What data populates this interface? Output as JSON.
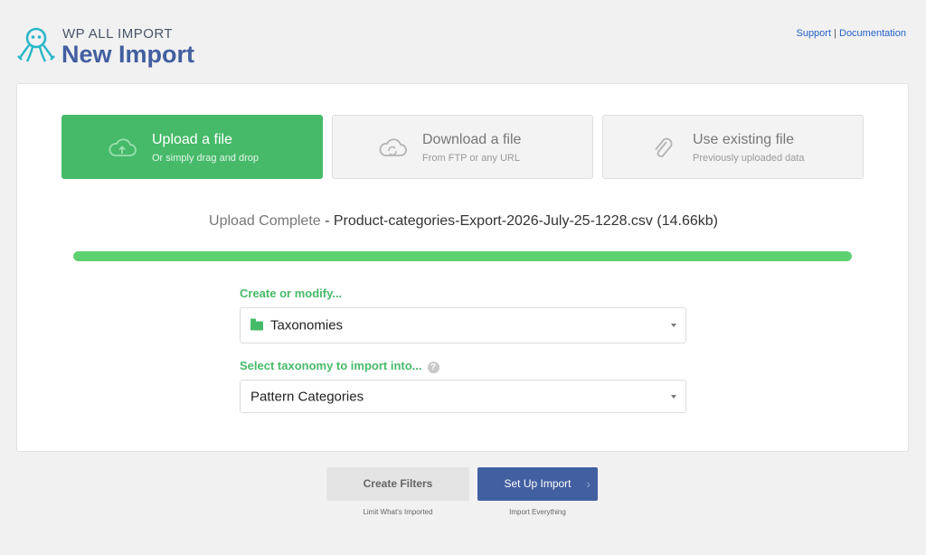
{
  "header": {
    "brand_small": "WP ALL IMPORT",
    "title": "New Import",
    "links": {
      "support": "Support",
      "separator": "|",
      "documentation": "Documentation"
    }
  },
  "sources": [
    {
      "title": "Upload a file",
      "subtitle": "Or simply drag and drop",
      "icon": "cloud-upload-icon",
      "active": true
    },
    {
      "title": "Download a file",
      "subtitle": "From FTP or any URL",
      "icon": "cloud-sync-icon",
      "active": false
    },
    {
      "title": "Use existing file",
      "subtitle": "Previously uploaded data",
      "icon": "paperclip-icon",
      "active": false
    }
  ],
  "upload": {
    "status_label": "Upload Complete",
    "separator": " - ",
    "filename": "Product-categories-Export-2026-July-25-1228.csv (14.66kb)",
    "progress": 1.0
  },
  "form": {
    "create_label": "Create or modify...",
    "create_value": "Taxonomies",
    "taxonomy_label": "Select taxonomy to import into...",
    "taxonomy_value": "Pattern Categories"
  },
  "actions": {
    "filters_label": "Create Filters",
    "filters_caption": "Limit What's Imported",
    "setup_label": "Set Up Import",
    "setup_caption": "Import Everything",
    "setup_arrow": "›"
  },
  "colors": {
    "accent_green": "#46ba69",
    "progress_green": "#5cd16f",
    "brand_blue": "#425fa0",
    "link_blue": "#2563c9"
  }
}
